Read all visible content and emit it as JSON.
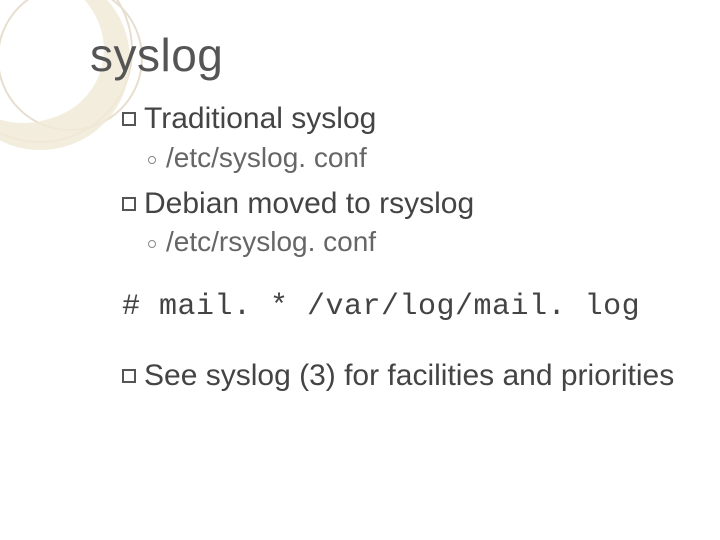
{
  "slide": {
    "title": "syslog",
    "bullets": [
      {
        "text": "Traditional syslog",
        "sub": "/etc/syslog. conf"
      },
      {
        "text": "Debian moved to rsyslog",
        "sub": "/etc/rsyslog. conf"
      }
    ],
    "code": "# mail. * /var/log/mail. log",
    "bullet_last": "See syslog (3) for facilities and priorities"
  }
}
